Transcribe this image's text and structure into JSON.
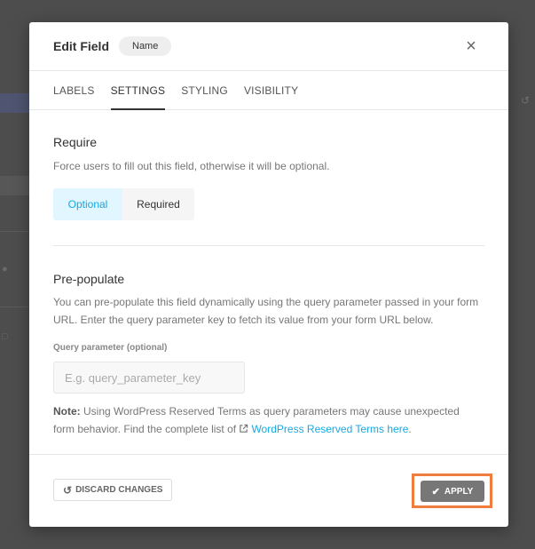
{
  "modal": {
    "title": "Edit Field",
    "field_type": "Name",
    "close_symbol": "×"
  },
  "tabs": [
    {
      "label": "LABELS"
    },
    {
      "label": "SETTINGS"
    },
    {
      "label": "STYLING"
    },
    {
      "label": "VISIBILITY"
    }
  ],
  "active_tab": "SETTINGS",
  "require": {
    "title": "Require",
    "description": "Force users to fill out this field, otherwise it will be optional.",
    "options": [
      "Optional",
      "Required"
    ],
    "selected": "Optional"
  },
  "prepopulate": {
    "title": "Pre-populate",
    "description": "You can pre-populate this field dynamically using the query parameter passed in your form URL. Enter the query parameter key to fetch its value from your form URL below.",
    "field_label": "Query parameter (optional)",
    "placeholder": "E.g. query_parameter_key",
    "value": "",
    "note_prefix": "Note:",
    "note_text": " Using WordPress Reserved Terms as query parameters may cause unexpected form behavior. Find the complete list of ",
    "note_link": "WordPress Reserved Terms here",
    "note_suffix": "."
  },
  "footer": {
    "discard_label": "DISCARD CHANGES",
    "apply_label": "APPLY"
  },
  "colors": {
    "accent": "#17a8e3",
    "selected_bg": "#e1f6fe",
    "apply_bg": "#777777",
    "highlight": "#f07d3d"
  },
  "icons": {
    "close": "close-icon",
    "undo": "undo-icon",
    "check": "check-icon",
    "external_link": "external-link-icon"
  }
}
